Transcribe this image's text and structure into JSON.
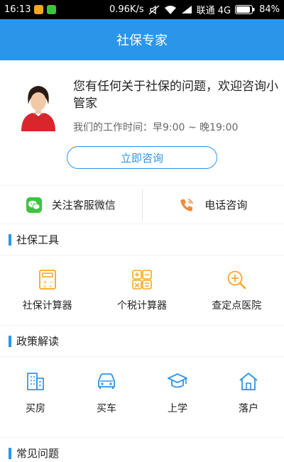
{
  "status_bar": {
    "time": "16:13",
    "network_speed": "0.96K/s",
    "carrier": "联通 4G",
    "battery": "84%",
    "badge_colors": [
      "#f5a623",
      "#3ec43e"
    ]
  },
  "app_bar": {
    "title": "社保专家"
  },
  "intro": {
    "message": "您有任何关于社保的问题，欢迎咨询小管家",
    "hours": "我们的工作时间：早9:00 ~ 晚19:00",
    "consult_button": "立即咨询"
  },
  "contact": {
    "wechat_label": "关注客服微信",
    "phone_label": "电话咨询"
  },
  "tools_section": {
    "title": "社保工具",
    "items": [
      {
        "label": "社保计算器",
        "icon": "calculator-icon"
      },
      {
        "label": "个税计算器",
        "icon": "tax-calculator-icon"
      },
      {
        "label": "查定点医院",
        "icon": "hospital-search-icon"
      }
    ]
  },
  "policy_section": {
    "title": "政策解读",
    "items": [
      {
        "label": "买房",
        "icon": "building-icon"
      },
      {
        "label": "买车",
        "icon": "car-icon"
      },
      {
        "label": "上学",
        "icon": "graduation-cap-icon"
      },
      {
        "label": "落户",
        "icon": "house-icon"
      }
    ]
  },
  "faq_section": {
    "title": "常见问题"
  },
  "colors": {
    "accent": "#2b95ea",
    "tool_icon": "#f5a623",
    "wechat": "#3ec43e",
    "phone": "#f08a3c"
  }
}
